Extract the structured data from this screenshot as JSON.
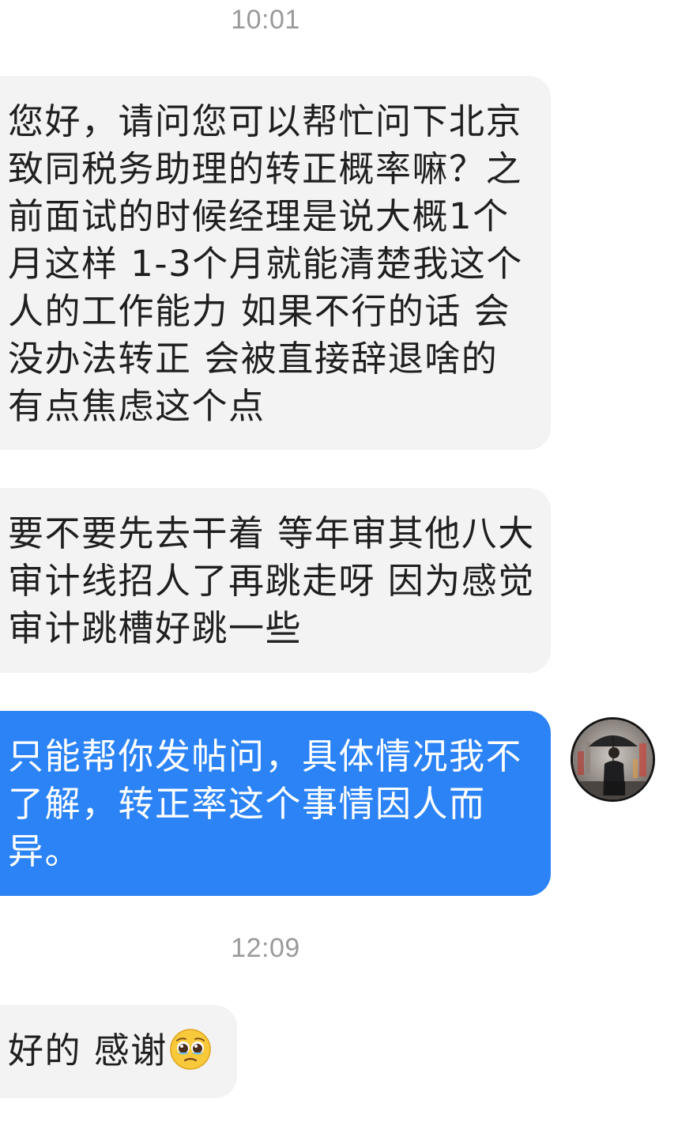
{
  "timestamps": {
    "first": "10:01",
    "second": "12:09"
  },
  "messages": [
    {
      "direction": "incoming",
      "text": "您好，请问您可以帮忙问下北京致同税务助理的转正概率嘛？之前面试的时候经理是说大概1个月这样 1-3个月就能清楚我这个人的工作能力 如果不行的话 会没办法转正 会被直接辞退啥的 有点焦虑这个点"
    },
    {
      "direction": "incoming",
      "text": "要不要先去干着 等年审其他八大审计线招人了再跳走呀 因为感觉审计跳槽好跳一些"
    },
    {
      "direction": "outgoing",
      "text": "只能帮你发帖问，具体情况我不了解，转正率这个事情因人而异。"
    },
    {
      "direction": "incoming",
      "text": "好的 感谢",
      "emoji": "pleading-face-icon"
    }
  ],
  "colors": {
    "incoming_bubble": "#f3f3f3",
    "outgoing_bubble": "#2b83f6",
    "timestamp": "#9a9a9a"
  }
}
